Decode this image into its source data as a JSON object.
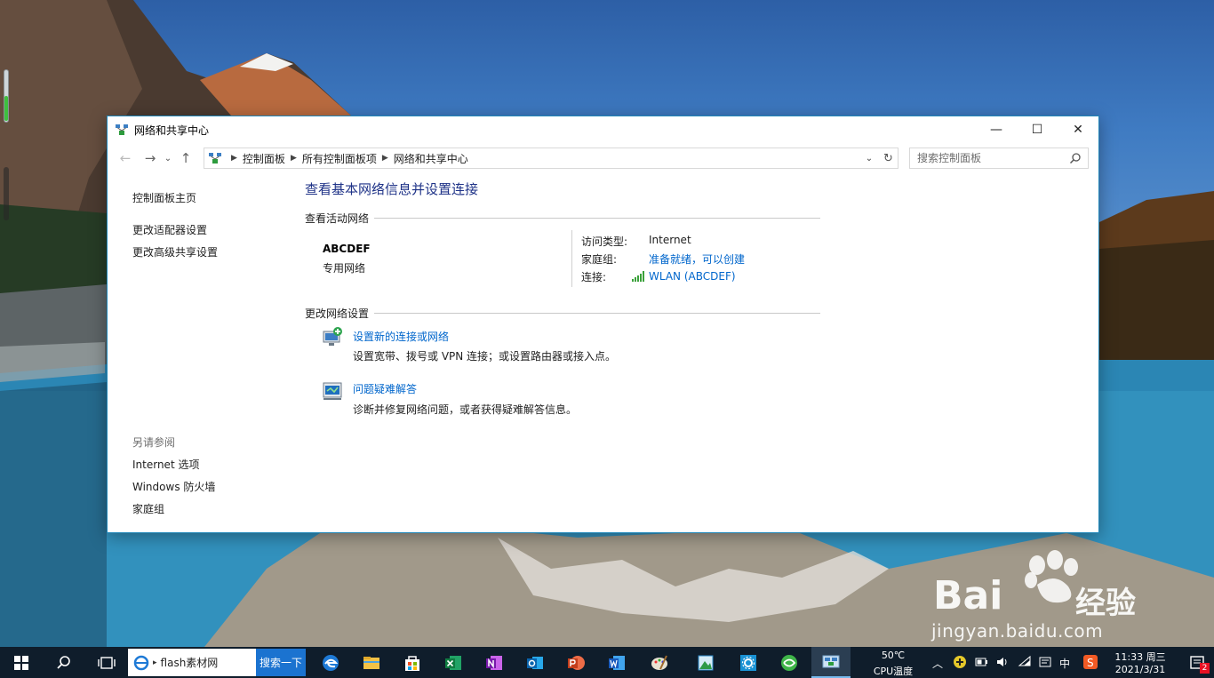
{
  "window": {
    "title": "网络和共享中心",
    "minimize": "—",
    "maximize": "☐",
    "close": "✕"
  },
  "address": {
    "crumbs": [
      "控制面板",
      "所有控制面板项",
      "网络和共享中心"
    ],
    "search_placeholder": "搜索控制面板"
  },
  "sidebar": {
    "home": "控制面板主页",
    "links": [
      "更改适配器设置",
      "更改高级共享设置"
    ],
    "see_also_title": "另请参阅",
    "see_also": [
      "Internet 选项",
      "Windows 防火墙",
      "家庭组"
    ]
  },
  "main": {
    "heading": "查看基本网络信息并设置连接",
    "active_networks_title": "查看活动网络",
    "network": {
      "name": "ABCDEF",
      "type": "专用网络",
      "access_label": "访问类型:",
      "access_value": "Internet",
      "homegroup_label": "家庭组:",
      "homegroup_value": "准备就绪，可以创建",
      "connection_label": "连接:",
      "connection_value": "WLAN (ABCDEF)"
    },
    "change_settings_title": "更改网络设置",
    "tasks": [
      {
        "link": "设置新的连接或网络",
        "desc": "设置宽带、拨号或 VPN 连接；或设置路由器或接入点。"
      },
      {
        "link": "问题疑难解答",
        "desc": "诊断并修复网络问题，或者获得疑难解答信息。"
      }
    ]
  },
  "taskbar": {
    "search_text": "flash素材网",
    "search_button": "搜索一下",
    "temp_value": "50℃",
    "temp_label": "CPU温度",
    "ime": "中",
    "time": "11:33 周三",
    "date": "2021/3/31",
    "notification_count": "2"
  },
  "watermark": {
    "brand": "Bai",
    "brand2": "经验",
    "url": "jingyan.baidu.com"
  },
  "colors": {
    "accent_link": "#0066cc",
    "heading": "#1e3287",
    "window_border": "#1f86b8",
    "taskbar": "#0f1d2b"
  }
}
